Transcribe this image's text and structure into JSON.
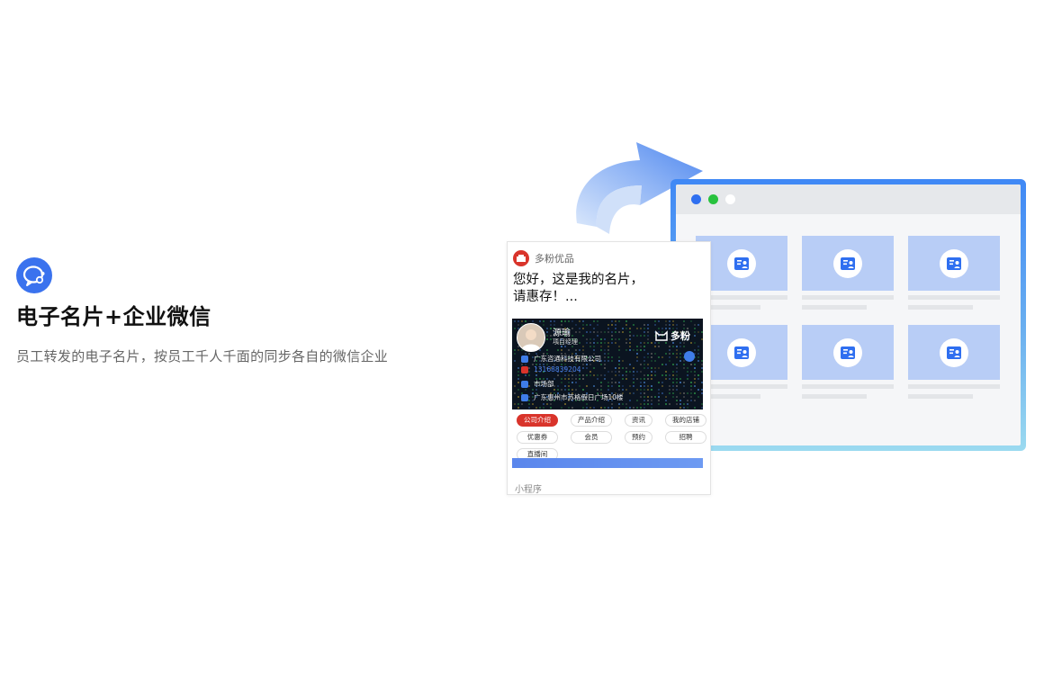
{
  "feature": {
    "title": "电子名片+企业微信",
    "description": "员工转发的电子名片，按员工千人千面的同步各自的微信企业"
  },
  "mini_program": {
    "app_name": "多粉优品",
    "greeting_line1": "您好，这是我的名片，",
    "greeting_line2": "请惠存！...",
    "card": {
      "name": "源瑜",
      "role": "项目经理",
      "brand": "多粉",
      "company": "广东咨通科技有限公司",
      "phone": "13168839204",
      "department": "市场部",
      "address": "广东惠州市苏格假日广场10楼"
    },
    "chips": [
      "公司介绍",
      "产品介绍",
      "资讯",
      "我的店铺",
      "优惠券",
      "会员",
      "预约",
      "招聘",
      "直播间"
    ],
    "footer": "小程序"
  },
  "colors": {
    "accent": "#3a72ee",
    "brand_red": "#d9342b",
    "tile": "#b8cdf6",
    "dot_blue": "#2f6ff0",
    "dot_green": "#28c23e",
    "dot_white": "#ffffff"
  }
}
